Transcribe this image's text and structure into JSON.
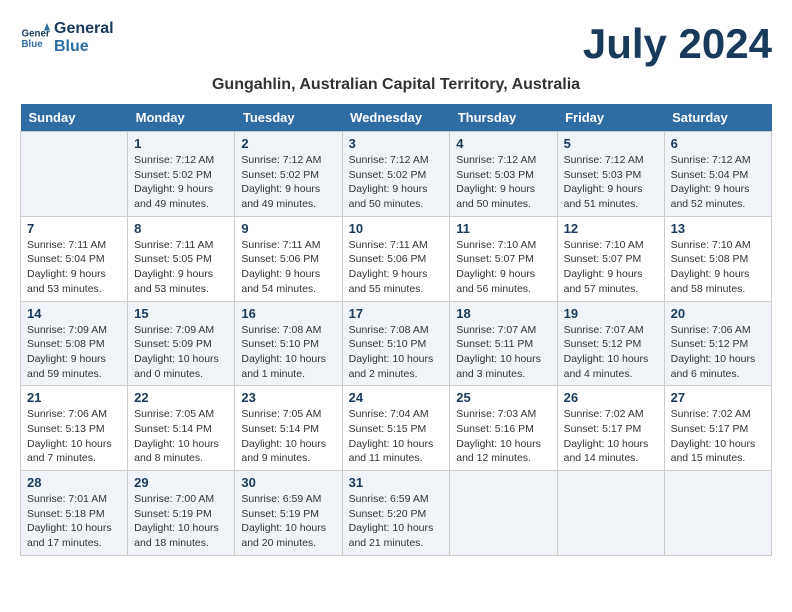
{
  "header": {
    "logo_line1": "General",
    "logo_line2": "Blue",
    "month_year": "July 2024",
    "location": "Gungahlin, Australian Capital Territory, Australia"
  },
  "weekdays": [
    "Sunday",
    "Monday",
    "Tuesday",
    "Wednesday",
    "Thursday",
    "Friday",
    "Saturday"
  ],
  "weeks": [
    [
      {
        "day": "",
        "content": ""
      },
      {
        "day": "1",
        "content": "Sunrise: 7:12 AM\nSunset: 5:02 PM\nDaylight: 9 hours\nand 49 minutes."
      },
      {
        "day": "2",
        "content": "Sunrise: 7:12 AM\nSunset: 5:02 PM\nDaylight: 9 hours\nand 49 minutes."
      },
      {
        "day": "3",
        "content": "Sunrise: 7:12 AM\nSunset: 5:02 PM\nDaylight: 9 hours\nand 50 minutes."
      },
      {
        "day": "4",
        "content": "Sunrise: 7:12 AM\nSunset: 5:03 PM\nDaylight: 9 hours\nand 50 minutes."
      },
      {
        "day": "5",
        "content": "Sunrise: 7:12 AM\nSunset: 5:03 PM\nDaylight: 9 hours\nand 51 minutes."
      },
      {
        "day": "6",
        "content": "Sunrise: 7:12 AM\nSunset: 5:04 PM\nDaylight: 9 hours\nand 52 minutes."
      }
    ],
    [
      {
        "day": "7",
        "content": "Sunrise: 7:11 AM\nSunset: 5:04 PM\nDaylight: 9 hours\nand 53 minutes."
      },
      {
        "day": "8",
        "content": "Sunrise: 7:11 AM\nSunset: 5:05 PM\nDaylight: 9 hours\nand 53 minutes."
      },
      {
        "day": "9",
        "content": "Sunrise: 7:11 AM\nSunset: 5:06 PM\nDaylight: 9 hours\nand 54 minutes."
      },
      {
        "day": "10",
        "content": "Sunrise: 7:11 AM\nSunset: 5:06 PM\nDaylight: 9 hours\nand 55 minutes."
      },
      {
        "day": "11",
        "content": "Sunrise: 7:10 AM\nSunset: 5:07 PM\nDaylight: 9 hours\nand 56 minutes."
      },
      {
        "day": "12",
        "content": "Sunrise: 7:10 AM\nSunset: 5:07 PM\nDaylight: 9 hours\nand 57 minutes."
      },
      {
        "day": "13",
        "content": "Sunrise: 7:10 AM\nSunset: 5:08 PM\nDaylight: 9 hours\nand 58 minutes."
      }
    ],
    [
      {
        "day": "14",
        "content": "Sunrise: 7:09 AM\nSunset: 5:08 PM\nDaylight: 9 hours\nand 59 minutes."
      },
      {
        "day": "15",
        "content": "Sunrise: 7:09 AM\nSunset: 5:09 PM\nDaylight: 10 hours\nand 0 minutes."
      },
      {
        "day": "16",
        "content": "Sunrise: 7:08 AM\nSunset: 5:10 PM\nDaylight: 10 hours\nand 1 minute."
      },
      {
        "day": "17",
        "content": "Sunrise: 7:08 AM\nSunset: 5:10 PM\nDaylight: 10 hours\nand 2 minutes."
      },
      {
        "day": "18",
        "content": "Sunrise: 7:07 AM\nSunset: 5:11 PM\nDaylight: 10 hours\nand 3 minutes."
      },
      {
        "day": "19",
        "content": "Sunrise: 7:07 AM\nSunset: 5:12 PM\nDaylight: 10 hours\nand 4 minutes."
      },
      {
        "day": "20",
        "content": "Sunrise: 7:06 AM\nSunset: 5:12 PM\nDaylight: 10 hours\nand 6 minutes."
      }
    ],
    [
      {
        "day": "21",
        "content": "Sunrise: 7:06 AM\nSunset: 5:13 PM\nDaylight: 10 hours\nand 7 minutes."
      },
      {
        "day": "22",
        "content": "Sunrise: 7:05 AM\nSunset: 5:14 PM\nDaylight: 10 hours\nand 8 minutes."
      },
      {
        "day": "23",
        "content": "Sunrise: 7:05 AM\nSunset: 5:14 PM\nDaylight: 10 hours\nand 9 minutes."
      },
      {
        "day": "24",
        "content": "Sunrise: 7:04 AM\nSunset: 5:15 PM\nDaylight: 10 hours\nand 11 minutes."
      },
      {
        "day": "25",
        "content": "Sunrise: 7:03 AM\nSunset: 5:16 PM\nDaylight: 10 hours\nand 12 minutes."
      },
      {
        "day": "26",
        "content": "Sunrise: 7:02 AM\nSunset: 5:17 PM\nDaylight: 10 hours\nand 14 minutes."
      },
      {
        "day": "27",
        "content": "Sunrise: 7:02 AM\nSunset: 5:17 PM\nDaylight: 10 hours\nand 15 minutes."
      }
    ],
    [
      {
        "day": "28",
        "content": "Sunrise: 7:01 AM\nSunset: 5:18 PM\nDaylight: 10 hours\nand 17 minutes."
      },
      {
        "day": "29",
        "content": "Sunrise: 7:00 AM\nSunset: 5:19 PM\nDaylight: 10 hours\nand 18 minutes."
      },
      {
        "day": "30",
        "content": "Sunrise: 6:59 AM\nSunset: 5:19 PM\nDaylight: 10 hours\nand 20 minutes."
      },
      {
        "day": "31",
        "content": "Sunrise: 6:59 AM\nSunset: 5:20 PM\nDaylight: 10 hours\nand 21 minutes."
      },
      {
        "day": "",
        "content": ""
      },
      {
        "day": "",
        "content": ""
      },
      {
        "day": "",
        "content": ""
      }
    ]
  ]
}
